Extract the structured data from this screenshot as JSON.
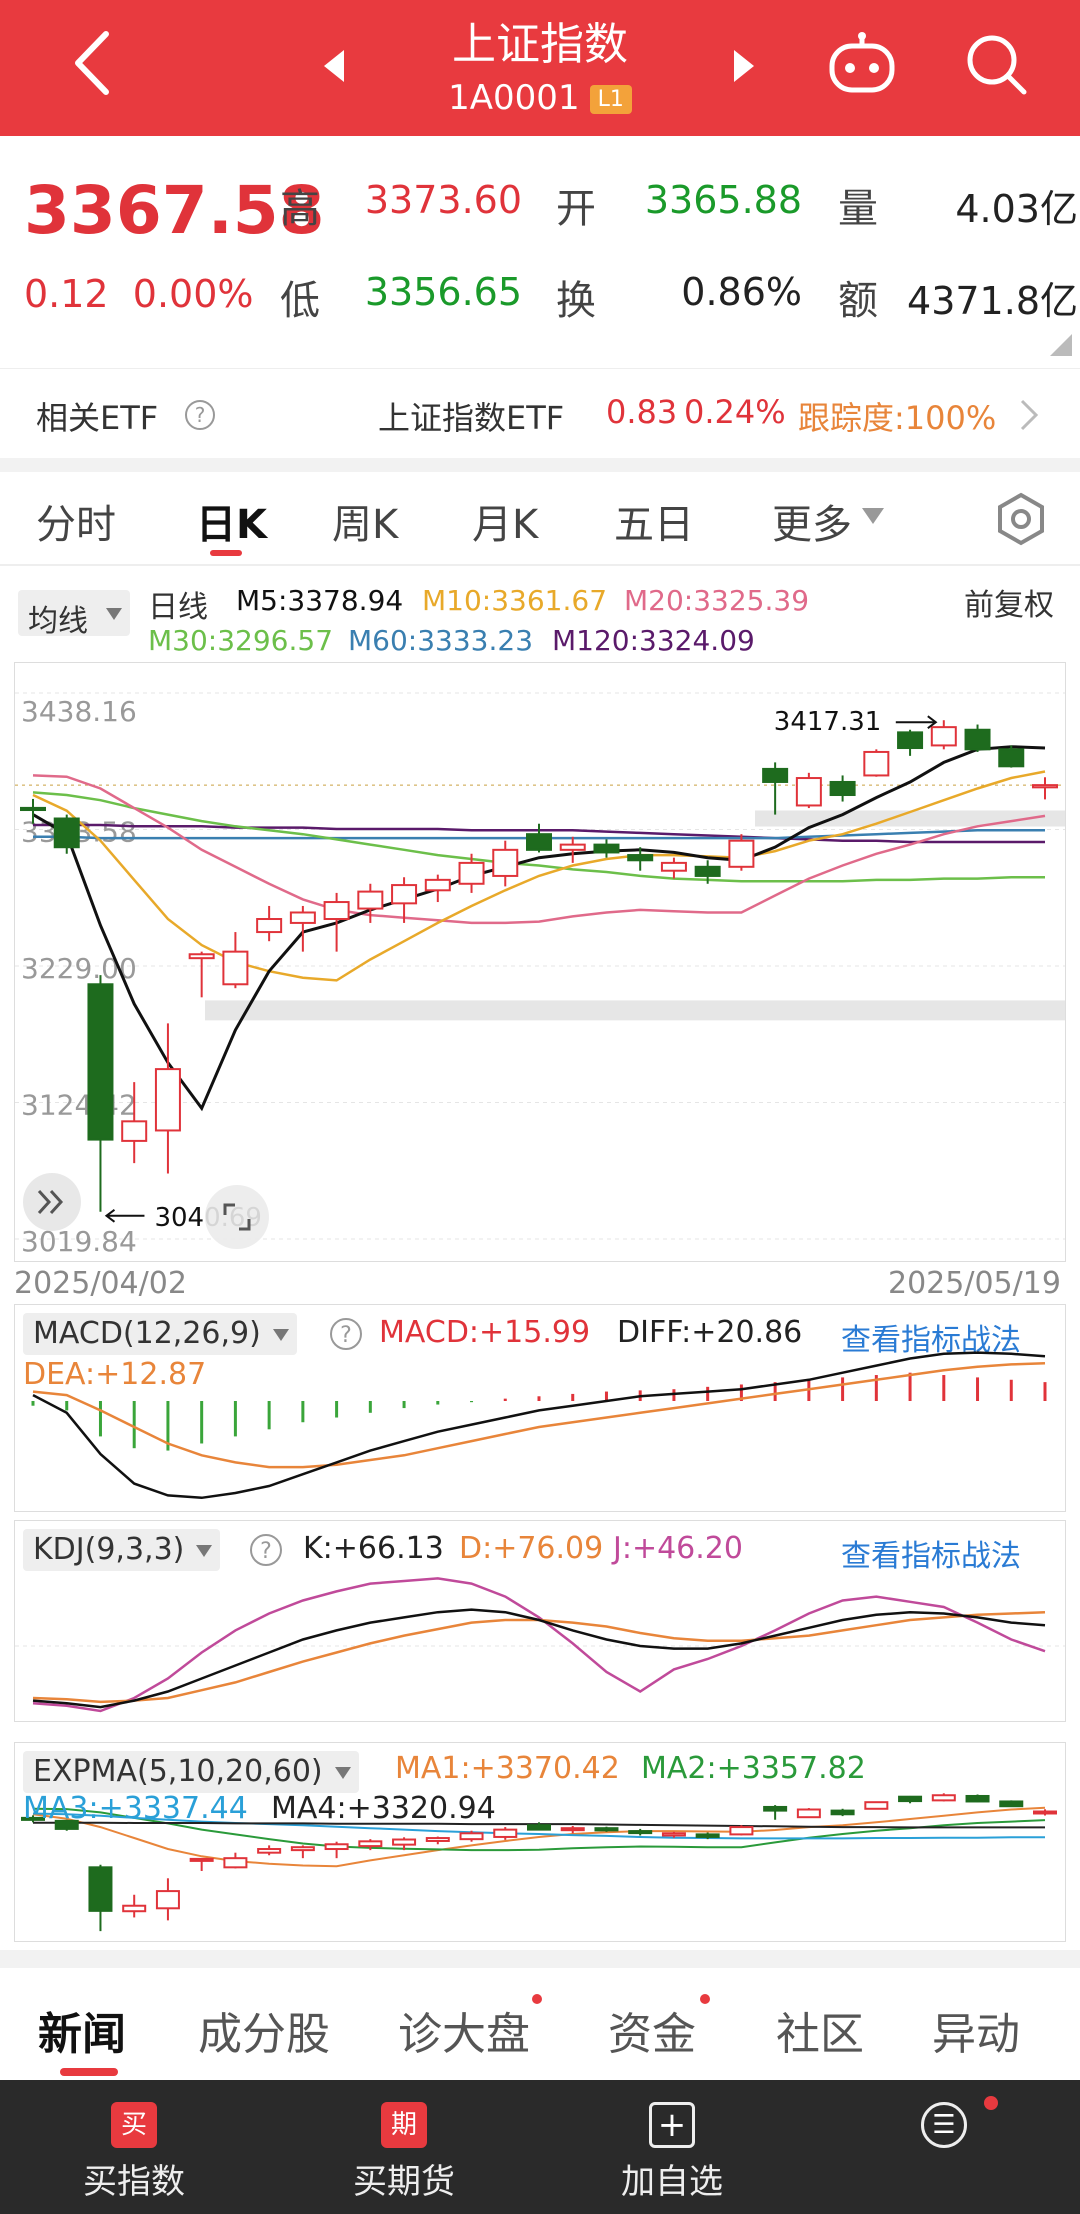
{
  "header": {
    "title": "上证指数",
    "code": "1A0001",
    "badge": "L1"
  },
  "quote": {
    "price": "3367.58",
    "change": "0.12",
    "change_pct": "0.00%",
    "labels": {
      "high": "高",
      "low": "低",
      "open": "开",
      "turnover": "换",
      "volume": "量",
      "amount": "额"
    },
    "high": "3373.60",
    "low": "3356.65",
    "open": "3365.88",
    "turnover": "0.86%",
    "volume": "4.03亿",
    "amount": "4371.8亿"
  },
  "etf": {
    "label": "相关ETF",
    "name": "上证指数ETF",
    "price": "0.83",
    "pct": "0.24%",
    "tracking": "跟踪度:100%"
  },
  "tabs": [
    "分时",
    "日K",
    "周K",
    "月K",
    "五日",
    "更多"
  ],
  "ma_legend": {
    "mode": "均线",
    "period": "日线",
    "m5": "M5:3378.94",
    "m10": "M10:3361.67",
    "m20": "M20:3325.39",
    "m30": "M30:3296.57",
    "m60": "M60:3333.23",
    "m120": "M120:3324.09",
    "adjust": "前复权"
  },
  "colors": {
    "up": "#e0333a",
    "down": "#1e6b1e",
    "m5": "#111111",
    "m10": "#e8a92a",
    "m20": "#e06a8a",
    "m30": "#6cbf4a",
    "m60": "#3a7fb0",
    "m120": "#5a1a6a"
  },
  "chart_data": {
    "type": "candlestick",
    "y_ticks": [
      "3438.16",
      "3333.58",
      "3229.00",
      "3124.42",
      "3019.84"
    ],
    "ylim": [
      3019.84,
      3438.16
    ],
    "date_start": "2025/04/02",
    "date_end": "2025/05/19",
    "annotations": {
      "high": "3417.31",
      "low": "3040.69"
    },
    "candles": [
      [
        3350.13,
        3357.0,
        3338.0,
        3348.5
      ],
      [
        3342.0,
        3345.0,
        3315.0,
        3320.0
      ],
      [
        3215.0,
        3222.0,
        3040.69,
        3096.0
      ],
      [
        3095.0,
        3140.0,
        3078.0,
        3110.0
      ],
      [
        3103.0,
        3185.0,
        3070.0,
        3150.0
      ],
      [
        3235.0,
        3240.0,
        3205.0,
        3238.0
      ],
      [
        3215.0,
        3255.0,
        3212.0,
        3240.0
      ],
      [
        3255.0,
        3275.0,
        3248.0,
        3265.0
      ],
      [
        3262.0,
        3275.0,
        3240.0,
        3270.0
      ],
      [
        3265.0,
        3285.0,
        3240.0,
        3278.0
      ],
      [
        3273.0,
        3292.0,
        3262.0,
        3286.0
      ],
      [
        3277.0,
        3297.0,
        3262.0,
        3291.0
      ],
      [
        3287.0,
        3299.0,
        3278.0,
        3295.0
      ],
      [
        3292.0,
        3315.0,
        3285.0,
        3308.0
      ],
      [
        3298.0,
        3325.0,
        3290.0,
        3318.0
      ],
      [
        3330.0,
        3338.0,
        3316.0,
        3318.0
      ],
      [
        3318.0,
        3328.0,
        3308.0,
        3322.0
      ],
      [
        3322.0,
        3326.0,
        3312.0,
        3316.0
      ],
      [
        3314.0,
        3320.0,
        3302.0,
        3310.0
      ],
      [
        3302.0,
        3312.0,
        3296.0,
        3308.0
      ],
      [
        3305.0,
        3310.0,
        3292.0,
        3298.0
      ],
      [
        3305.0,
        3330.0,
        3302.0,
        3325.0
      ],
      [
        3380.0,
        3385.0,
        3345.0,
        3370.0
      ],
      [
        3352.0,
        3377.0,
        3350.0,
        3373.0
      ],
      [
        3370.0,
        3375.0,
        3355.0,
        3360.0
      ],
      [
        3375.0,
        3395.0,
        3374.0,
        3393.0
      ],
      [
        3408.0,
        3410.0,
        3390.0,
        3396.0
      ],
      [
        3398.0,
        3417.31,
        3395.0,
        3412.0
      ],
      [
        3410.0,
        3414.0,
        3393.0,
        3395.0
      ],
      [
        3395.0,
        3398.0,
        3381.0,
        3382.0
      ],
      [
        3365.88,
        3373.6,
        3356.65,
        3367.58
      ]
    ],
    "ma": {
      "m5": [
        3345,
        3330,
        3260,
        3200,
        3155,
        3120,
        3180,
        3225,
        3255,
        3262,
        3272,
        3280,
        3288,
        3298,
        3305,
        3312,
        3315,
        3317,
        3318,
        3316,
        3312,
        3310,
        3320,
        3335,
        3345,
        3358,
        3370,
        3385,
        3395,
        3397,
        3396
      ],
      "m10": [
        3360,
        3348,
        3325,
        3295,
        3265,
        3245,
        3232,
        3225,
        3220,
        3218,
        3234,
        3248,
        3262,
        3275,
        3287,
        3298,
        3306,
        3311,
        3314,
        3314,
        3313,
        3312,
        3317,
        3325,
        3330,
        3338,
        3347,
        3356,
        3365,
        3373,
        3378
      ],
      "m20": [
        3375,
        3374,
        3365,
        3350,
        3335,
        3318,
        3305,
        3292,
        3280,
        3272,
        3268,
        3266,
        3264,
        3262,
        3262,
        3263,
        3267,
        3270,
        3272,
        3271,
        3270,
        3270,
        3283,
        3296,
        3306,
        3315,
        3322,
        3330,
        3336,
        3340,
        3344
      ],
      "m30": [
        3362,
        3360,
        3356,
        3350,
        3345,
        3340,
        3336,
        3333,
        3330,
        3326,
        3322,
        3318,
        3314,
        3311,
        3308,
        3306,
        3303,
        3301,
        3298,
        3296,
        3295,
        3294,
        3294,
        3294,
        3294,
        3295,
        3295,
        3296,
        3296,
        3297,
        3297
      ],
      "m60": [
        3328,
        3328,
        3327,
        3327,
        3327,
        3327,
        3327,
        3327,
        3327,
        3327,
        3327,
        3327,
        3327,
        3327,
        3327,
        3327,
        3327,
        3327,
        3327,
        3327,
        3327,
        3327,
        3327,
        3328,
        3329,
        3330,
        3331,
        3332,
        3333,
        3333,
        3333
      ],
      "m120": [
        3337,
        3337,
        3337,
        3336,
        3336,
        3336,
        3335,
        3335,
        3335,
        3334,
        3334,
        3334,
        3334,
        3333,
        3333,
        3333,
        3333,
        3332,
        3331,
        3330,
        3329,
        3328,
        3327,
        3326,
        3325,
        3325,
        3324,
        3324,
        3324,
        3324,
        3324
      ]
    }
  },
  "macd": {
    "label": "MACD(12,26,9)",
    "macd": "MACD:+15.99",
    "diff": "DIFF:+20.86",
    "dea": "DEA:+12.87",
    "link": "查看指标战法",
    "hist": [
      -4,
      -8,
      -30,
      -40,
      -42,
      -36,
      -30,
      -24,
      -18,
      -14,
      -10,
      -6,
      -3,
      -1,
      2,
      4,
      6,
      8,
      9,
      10,
      12,
      14,
      16,
      18,
      20,
      22,
      24,
      22,
      20,
      18,
      16
    ],
    "diff_line": [
      5,
      -10,
      -45,
      -70,
      -80,
      -82,
      -78,
      -72,
      -62,
      -52,
      -42,
      -34,
      -26,
      -20,
      -14,
      -8,
      -4,
      0,
      4,
      6,
      8,
      10,
      14,
      18,
      24,
      30,
      36,
      40,
      41,
      40,
      38
    ],
    "dea_line": [
      8,
      5,
      -8,
      -22,
      -36,
      -46,
      -52,
      -56,
      -56,
      -54,
      -50,
      -46,
      -40,
      -34,
      -28,
      -22,
      -18,
      -14,
      -10,
      -6,
      -2,
      2,
      6,
      10,
      14,
      18,
      22,
      26,
      29,
      31,
      32
    ]
  },
  "kdj": {
    "label": "KDJ(9,3,3)",
    "k": "K:+66.13",
    "d": "D:+76.09",
    "j": "J:+46.20",
    "link": "查看指标战法",
    "k_line": [
      8,
      6,
      3,
      8,
      15,
      25,
      35,
      45,
      55,
      62,
      68,
      72,
      76,
      78,
      76,
      70,
      62,
      55,
      50,
      48,
      48,
      52,
      58,
      64,
      70,
      74,
      76,
      75,
      72,
      68,
      66
    ],
    "d_line": [
      10,
      9,
      7,
      8,
      10,
      16,
      22,
      30,
      38,
      45,
      52,
      58,
      63,
      68,
      70,
      70,
      68,
      65,
      60,
      56,
      54,
      54,
      56,
      58,
      62,
      66,
      70,
      72,
      74,
      75,
      76
    ],
    "j_line": [
      6,
      4,
      0,
      10,
      25,
      45,
      62,
      75,
      85,
      92,
      98,
      100,
      102,
      98,
      88,
      72,
      52,
      30,
      15,
      32,
      40,
      50,
      62,
      75,
      85,
      88,
      84,
      80,
      68,
      55,
      46
    ]
  },
  "expma": {
    "label": "EXPMA(5,10,20,60)",
    "ma1": "MA1:+3370.42",
    "ma2": "MA2:+3357.82",
    "ma3": "MA3:+3337.44",
    "ma4": "MA4:+3320.94"
  },
  "bottom_tabs": [
    "新闻",
    "成分股",
    "诊大盘",
    "资金",
    "社区",
    "异动"
  ],
  "footer": [
    {
      "icon": "买",
      "label": "买指数"
    },
    {
      "icon": "期",
      "label": "买期货"
    },
    {
      "icon": "+",
      "label": "加自选"
    },
    {
      "icon": "☰",
      "label": ""
    }
  ]
}
